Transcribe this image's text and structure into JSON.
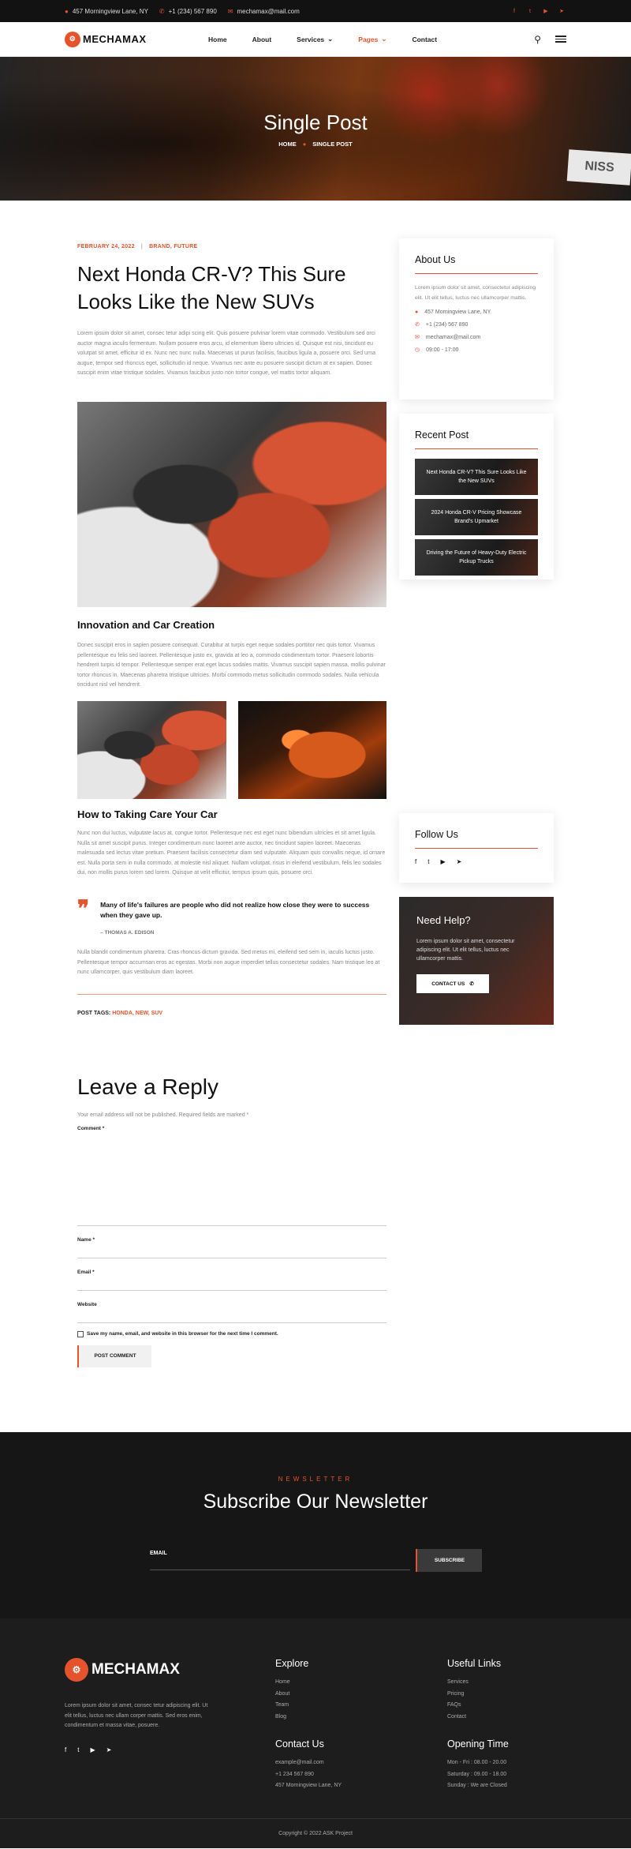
{
  "topbar": {
    "address": "457 Morningview Lane, NY",
    "phone": "+1 (234) 567 890",
    "email": "mechamax@mail.com",
    "socials": [
      "facebook-icon",
      "twitter-icon",
      "youtube-icon",
      "telegram-icon"
    ]
  },
  "nav": {
    "brand": "MECHAMAX",
    "items": [
      {
        "label": "Home"
      },
      {
        "label": "About"
      },
      {
        "label": "Services"
      },
      {
        "label": "Pages"
      },
      {
        "label": "Contact"
      }
    ]
  },
  "hero": {
    "title": "Single Post",
    "crumb_home": "HOME",
    "crumb_current": "SINGLE POST",
    "plate": "NISS"
  },
  "post": {
    "date": "FEBRUARY 24, 2022",
    "categories": "BRAND, FUTURE",
    "title": "Next Honda CR-V? This Sure Looks Like the New SUVs",
    "intro": "Lorem ipsum dolor sit amet, consec tetur adipi scing elit. Quis posuere pulvinar lorem vitae commodo. Vestibulum sed orci auctor magna iaculis fermentum. Nullam posuere eros arcu, id elementum libero ultricies id. Quisque est nisi, tincidunt eu volutpat sit amet, efficitur id ex. Nunc nec nunc nulla. Maecenas ut purus facilisis, faucibus ligula a, posuere orci. Sed urna augue, tempor sed rhoncus eget, sollicitudin id neque. Vivamus nec ante eu posuere suscipit dictum at ex sapien. Donec suscipit enim vitae tristique sodales. Vivamus faucibus justo non tortor congue, vel mattis tortor aliquam.",
    "h_innovation": "Innovation and Car Creation",
    "p_innovation": "Donec suscipit eros in sapien posuere consequat. Curabitur at turpis eget neque sodales porttitor nec quis tortor. Vivamus pellentesque eu felis sed laoreet. Pellentesque justo ex, gravida at leo a, commodo condimentum tortor. Praesent lobortis hendrerit turpis id tempor. Pellentesque semper erat eget lacus sodales mattis. Vivamus suscipit sapien massa, mollis pulvinar tortor rhoncus in. Maecenas pharetra tristique ultricies. Morbi commodo metus sollicitudin commodo sodales. Nulla vehicula tincidunt nisl vel hendrerit.",
    "h_how": "How to Taking Care Your Car",
    "p_how": "Nunc non dui luctus, vulputate lacus at, congue tortor. Pellentesque nec est eget nunc bibendum ultricies et sit amet ligula. Nulla sit amet suscipit purus. Integer condimentum nunc laoreet ante auctor, nec tincidunt sapien laoreet. Maecenas malesuada sed lectus vitae pretium. Praesent facilisis consectetur diam sed vulputate. Aliquam quis convallis neque, id ornare est. Nulla porta sem in nulla commodo, at molestie nisl aliquet. Nullam volutpat, risus in eleifend vestibulum, felis leo sodales dui, non mollis purus lorem sed lorem. Quisque at velit efficitur, tempus ipsum quis, posuere orci.",
    "quote": "Many of life's failures are people who did not realize how close they were to success when they gave up.",
    "quote_author": "– THOMAS A. EDISON",
    "p_outro": "Nulla blandit condimentum pharetra. Cras rhoncus dictum gravida. Sed metus mi, eleifend sed sem in, iaculis luctus justo. Pellentesque tempor accumsan eros ac egestas. Morbi non augue imperdiet tellus consectetur sodales. Nam tristique leo at nunc ullamcorper, quis vestibulum diam laoreet.",
    "tags_label": "POST TAGS:",
    "tags": "HONDA, NEW, SUV"
  },
  "sidebar": {
    "about_title": "About Us",
    "about_text": "Lorem ipsum dolor sit amet, consectetur adipiscing elit. Ut elit tellus, luctus nec ullamcorper mattis.",
    "address": "457 Morningview Lane, NY",
    "phone": "+1 (234) 567 890",
    "email": "mechamax@mail.com",
    "hours": "09:00 - 17:00",
    "recent_title": "Recent Post",
    "recent": [
      {
        "label": "Next Honda CR-V? This Sure Looks Like the New SUVs"
      },
      {
        "label": "2024 Honda CR-V Pricing Showcase Brand's Upmarket"
      },
      {
        "label": "Driving the Future of Heavy-Duty Electric Pickup Trucks"
      }
    ],
    "follow_title": "Follow Us",
    "help_title": "Need Help?",
    "help_text": "Lorem ipsum dolor sit amet, consectetur adipiscing elit. Ut elit tellus, luctus nec ullamcorper mattis.",
    "help_button": "CONTACT US"
  },
  "reply": {
    "title": "Leave a Reply",
    "note": "Your email address will not be published. Required fields are marked *",
    "comment_label": "Comment *",
    "name_label": "Name *",
    "email_label": "Email *",
    "website_label": "Website",
    "save_label": "Save my name, email, and website in this browser for the next time I comment.",
    "submit": "POST COMMENT"
  },
  "newsletter": {
    "eyebrow": "NEWSLETTER",
    "title": "Subscribe Our Newsletter",
    "email_label": "EMAIL",
    "button": "SUBSCRIBE"
  },
  "footer": {
    "brand": "MECHAMAX",
    "about": "Lorem ipsum dolor sit amet, consec tetur adipiscing elit. Ut elit tellus, luctus nec ullam corper mattis. Sed eros enim, condimentum et massa vitae, posuere.",
    "explore_title": "Explore",
    "explore": [
      "Home",
      "About",
      "Team",
      "Blog"
    ],
    "links_title": "Useful Links",
    "links": [
      "Services",
      "Pricing",
      "FAQs",
      "Contact"
    ],
    "contact_title": "Contact Us",
    "contact": [
      "example@mail.com",
      "+1 234 567 890",
      "457 Morningview Lane, NY"
    ],
    "hours_title": "Opening Time",
    "hours": [
      "Mon - Fri : 08.00 - 20.00",
      "Saturday : 09.00 - 18.00",
      "Sunday : We are Closed"
    ],
    "copyright": "Copyright © 2022 ASK Project"
  },
  "colors": {
    "accent": "#e5532d",
    "dark": "#161616"
  }
}
